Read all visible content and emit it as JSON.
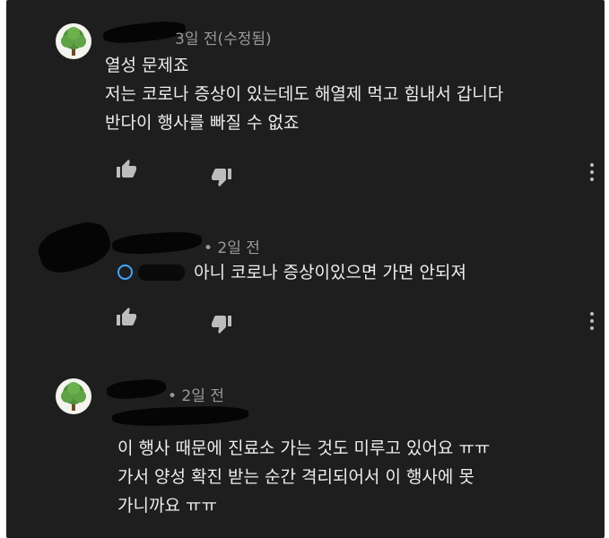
{
  "comments": [
    {
      "timestamp": "3일 전(수정됨)",
      "lines": [
        "열성 문제죠",
        "저는 코로나 증상이 있는데도 해열제 먹고 힘내서 갑니다",
        "반다이 행사를 빠질 수 없죠"
      ]
    },
    {
      "timestamp": "• 2일 전",
      "lines": [
        "아니 코로나 증상이있으면 가면 안되져"
      ]
    },
    {
      "timestamp": "• 2일 전",
      "lines": [
        "이 행사 때문에 진료소 가는 것도 미루고 있어요 ㅠㅠ",
        "가서 양성 확진 받는 순간 격리되어서 이 행사에 못",
        "가니까요 ㅠㅠ"
      ]
    }
  ],
  "icons": {
    "like": "thumbs-up-icon",
    "dislike": "thumbs-down-icon",
    "more": "more-vert-icon",
    "avatar": "tree-icon",
    "mention": "mention-icon"
  },
  "colors": {
    "background": "#1e1e1e",
    "text": "#ededed",
    "meta": "#9a9a9a",
    "mention": "#3ea6ff"
  }
}
